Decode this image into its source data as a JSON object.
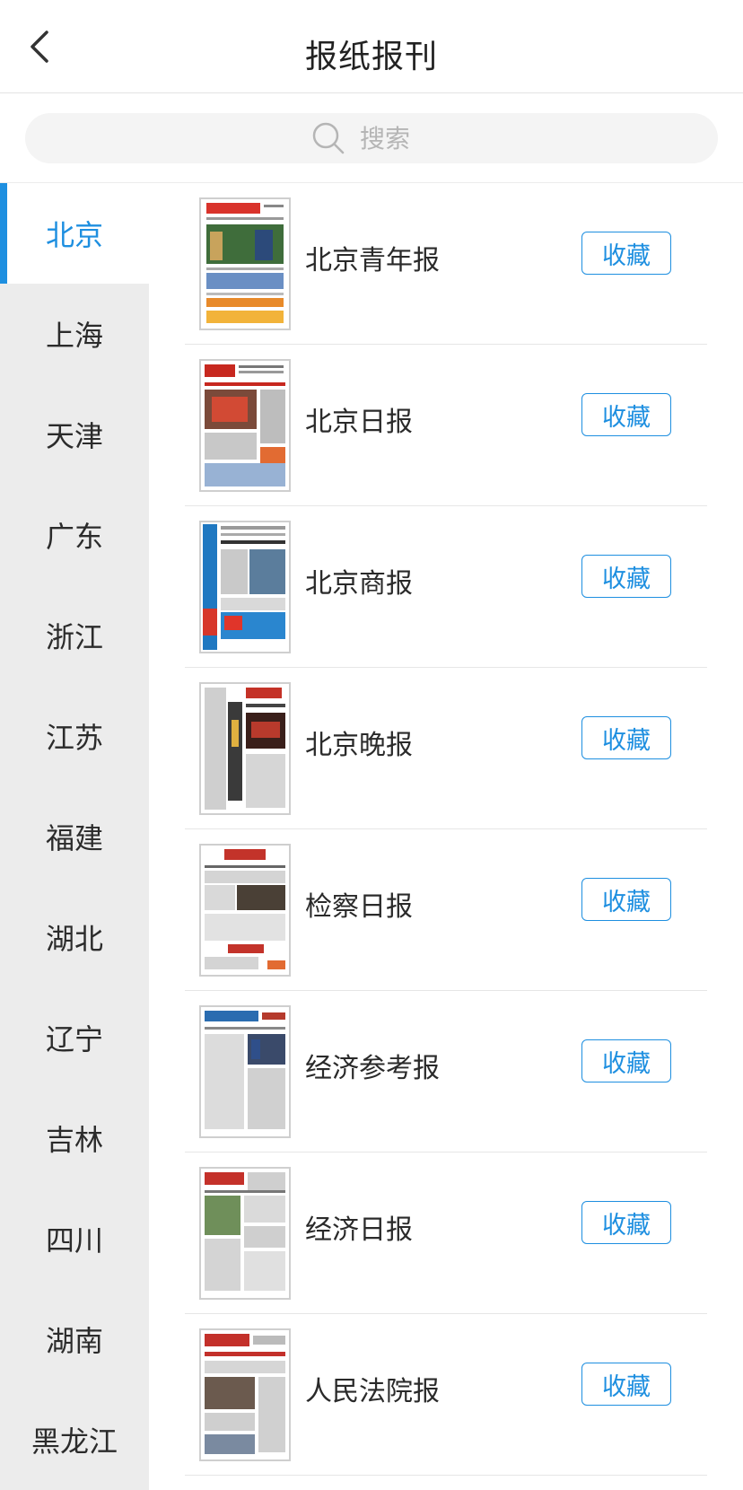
{
  "header": {
    "title": "报纸报刊"
  },
  "search": {
    "placeholder": "搜索"
  },
  "sidebar": {
    "items": [
      {
        "label": "北京",
        "active": true
      },
      {
        "label": "上海"
      },
      {
        "label": "天津"
      },
      {
        "label": "广东"
      },
      {
        "label": "浙江"
      },
      {
        "label": "江苏"
      },
      {
        "label": "福建"
      },
      {
        "label": "湖北"
      },
      {
        "label": "辽宁"
      },
      {
        "label": "吉林"
      },
      {
        "label": "四川"
      },
      {
        "label": "湖南"
      },
      {
        "label": "黑龙江"
      }
    ]
  },
  "papers": [
    {
      "name": "北京青年报",
      "button": "收藏"
    },
    {
      "name": "北京日报",
      "button": "收藏"
    },
    {
      "name": "北京商报",
      "button": "收藏"
    },
    {
      "name": "北京晚报",
      "button": "收藏"
    },
    {
      "name": "检察日报",
      "button": "收藏"
    },
    {
      "name": "经济参考报",
      "button": "收藏"
    },
    {
      "name": "经济日报",
      "button": "收藏"
    },
    {
      "name": "人民法院报",
      "button": "收藏"
    }
  ],
  "colors": {
    "accent": "#1e8fe0",
    "sidebar_bg": "#ececec"
  }
}
